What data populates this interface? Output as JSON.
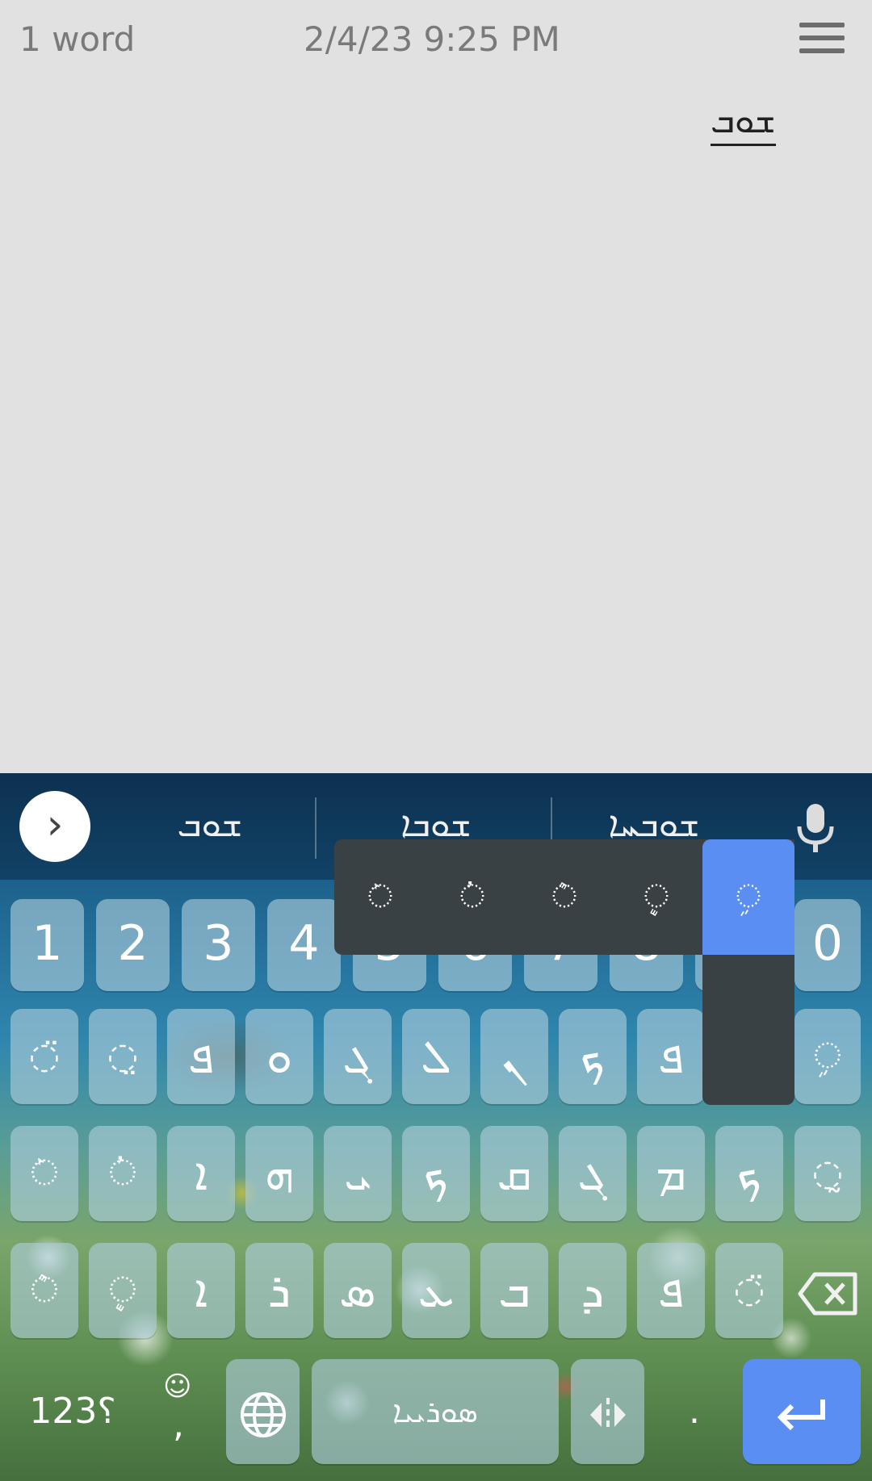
{
  "topbar": {
    "word_count": "1 word",
    "datetime": "2/4/23 9:25 PM",
    "menu_icon": "hamburger-menu-icon"
  },
  "document": {
    "text": "ܫܘܒ"
  },
  "keyboard": {
    "suggestions": [
      "ܫܘܒ",
      "ܫܘܒܐ",
      "ܫܘܒܚܐ"
    ],
    "expand_icon": "chevron-right-icon",
    "mic_icon": "microphone-icon",
    "number_row": [
      "1",
      "2",
      "3",
      "4",
      "5",
      "6",
      "7",
      "8",
      "9",
      "0"
    ],
    "row1": [
      "◌̈",
      "◌̤",
      "ܦ",
      "ܘ",
      "ܓ",
      "ܠ",
      "ܢ",
      "ܟ",
      "ܦ",
      "",
      "◌ܹ"
    ],
    "row2": [
      "◌ܰ",
      "◌ܳ",
      "ܐ",
      "ܗ",
      "ܝ",
      "ܟ",
      "ܩ",
      "ܓ",
      "ܡ",
      "ܟ",
      "◌̰"
    ],
    "row3": [
      "◌ܶ",
      "◌ܷ",
      "ܐ",
      "ܪ",
      "ܣ",
      "ܥ",
      "ܒ",
      "ܕ",
      "ܦ",
      "◌̈"
    ],
    "popup": [
      "◌ܰ",
      "◌ܳ",
      "◌ܶ",
      "◌ܷ",
      "◌ܹ"
    ],
    "symbols_label": "؟123",
    "emoji_comma": ",",
    "space_label": "ܣܘܪܝܝܐ",
    "period": ".",
    "backspace_icon": "backspace-icon",
    "globe_icon": "globe-icon",
    "cursor_icon": "cursor-move-icon",
    "enter_icon": "enter-arrow-icon"
  }
}
